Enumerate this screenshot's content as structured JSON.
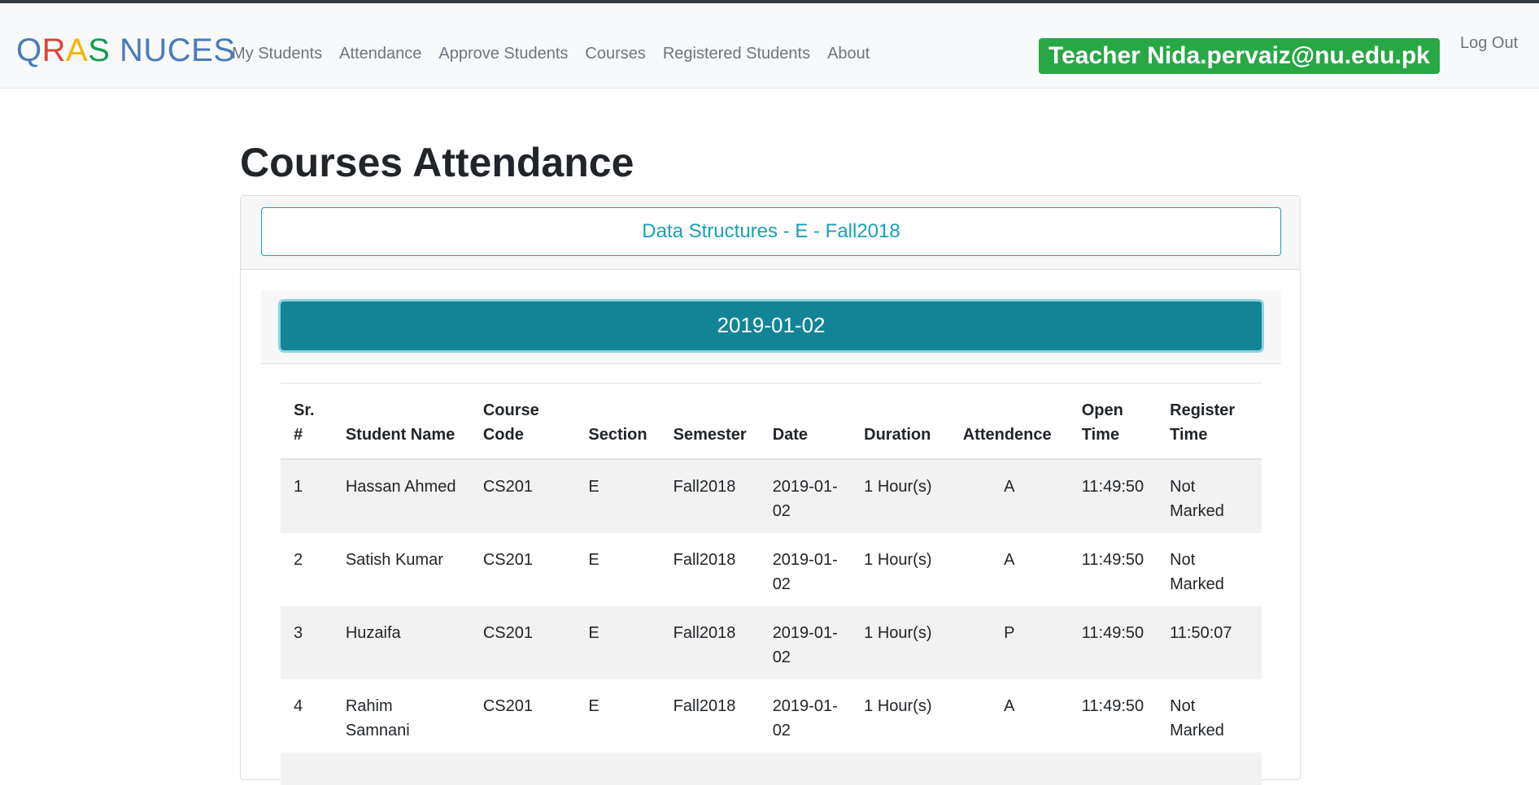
{
  "navbar": {
    "brand_letters": [
      {
        "char": "Q",
        "color": "#4a7bb7"
      },
      {
        "char": "R",
        "color": "#db4437"
      },
      {
        "char": "A",
        "color": "#f4b400"
      },
      {
        "char": "S",
        "color": "#0f9d58"
      },
      {
        "char": " NUCES",
        "color": "#4a7bb7"
      }
    ],
    "links": [
      "My Students",
      "Attendance",
      "Approve Students",
      "Courses",
      "Registered Students",
      "About"
    ],
    "teacher_badge": "Teacher Nida.pervaiz@nu.edu.pk",
    "logout_label": "Log Out"
  },
  "page": {
    "title": "Courses Attendance",
    "course_button": "Data Structures - E - Fall2018",
    "date_button": "2019-01-02"
  },
  "table": {
    "headers": [
      "Sr. #",
      "Student Name",
      "Course Code",
      "Section",
      "Semester",
      "Date",
      "Duration",
      "Attendence",
      "Open Time",
      "Register Time"
    ],
    "rows": [
      [
        "1",
        "Hassan Ahmed",
        "CS201",
        "E",
        "Fall2018",
        "2019-01-02",
        "1 Hour(s)",
        "A",
        "11:49:50",
        "Not Marked"
      ],
      [
        "2",
        "Satish Kumar",
        "CS201",
        "E",
        "Fall2018",
        "2019-01-02",
        "1 Hour(s)",
        "A",
        "11:49:50",
        "Not Marked"
      ],
      [
        "3",
        "Huzaifa",
        "CS201",
        "E",
        "Fall2018",
        "2019-01-02",
        "1 Hour(s)",
        "P",
        "11:49:50",
        "11:50:07"
      ],
      [
        "4",
        "Rahim Samnani",
        "CS201",
        "E",
        "Fall2018",
        "2019-01-02",
        "1 Hour(s)",
        "A",
        "11:49:50",
        "Not Marked"
      ]
    ]
  },
  "colors": {
    "accent_teal": "#17a2b8",
    "date_button_bg": "#138496",
    "badge_green": "#28a745",
    "nav_gray": "#6c757d"
  }
}
